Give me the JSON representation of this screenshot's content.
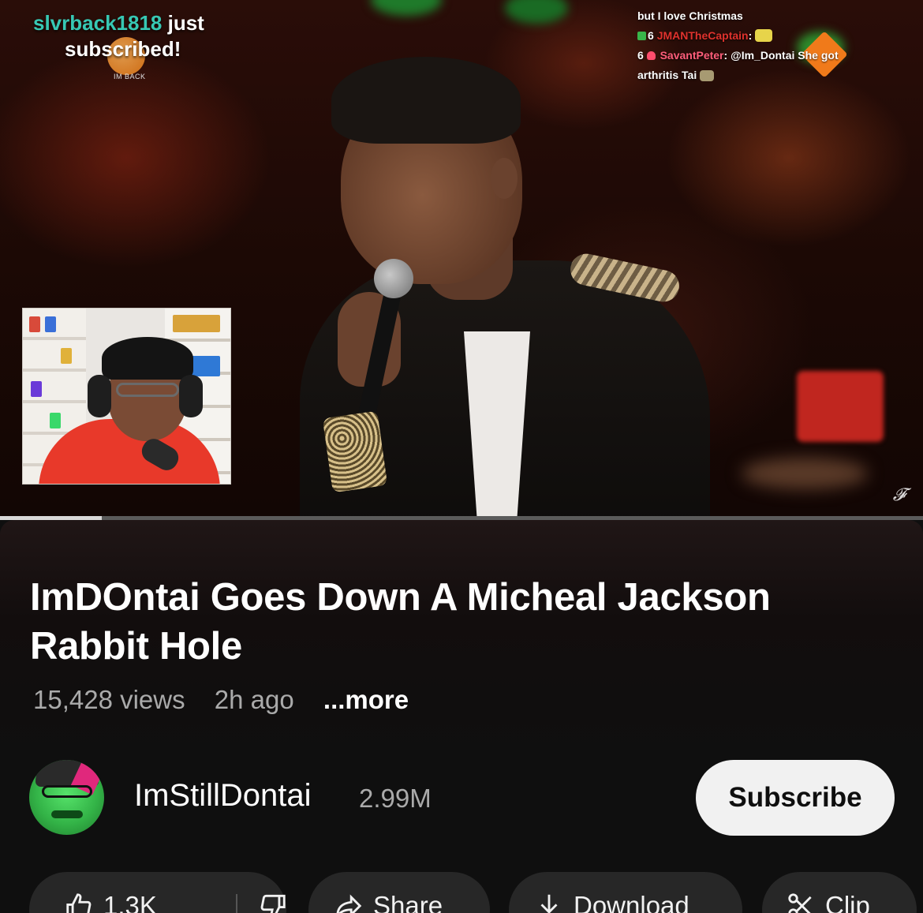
{
  "player": {
    "alert": {
      "username": "slvrback1818",
      "line1_suffix": " just",
      "line2": "subscribed!",
      "small_text": "IM BACK"
    },
    "chat": {
      "line1": "but I love Christmas",
      "msg2_badge_count": "6",
      "msg2_name": "JMANTheCaptain",
      "msg2_sep": ":",
      "msg3_badge_count": "6",
      "msg3_name": "SavantPeter",
      "msg3_text": ": @Im_Dontai She got",
      "msg3_text2": "arthritis Tai"
    },
    "watermark": "𝓕",
    "progress_fraction": 0.11
  },
  "video": {
    "title": "ImDOntai Goes Down A Micheal Jackson Rabbit Hole",
    "views": "15,428 views",
    "age": "2h ago",
    "more_label": "...more"
  },
  "channel": {
    "name": "ImStillDontai",
    "subscribers": "2.99M",
    "subscribe_label": "Subscribe"
  },
  "actions": {
    "like_count": "1.3K",
    "share_label": "Share",
    "download_label": "Download",
    "clip_label": "Clip"
  },
  "colors": {
    "background": "#0f0f0f",
    "alert_username": "#37c8b4",
    "chat_name_red": "#e0322d",
    "chat_name_pink": "#ff5e7a",
    "pill_bg": "#272727",
    "subscribe_bg": "#f1f1f1"
  },
  "icons": {
    "like": "thumbs-up-icon",
    "dislike": "thumbs-down-icon",
    "share": "share-arrow-icon",
    "download": "download-icon",
    "clip": "scissors-icon"
  }
}
